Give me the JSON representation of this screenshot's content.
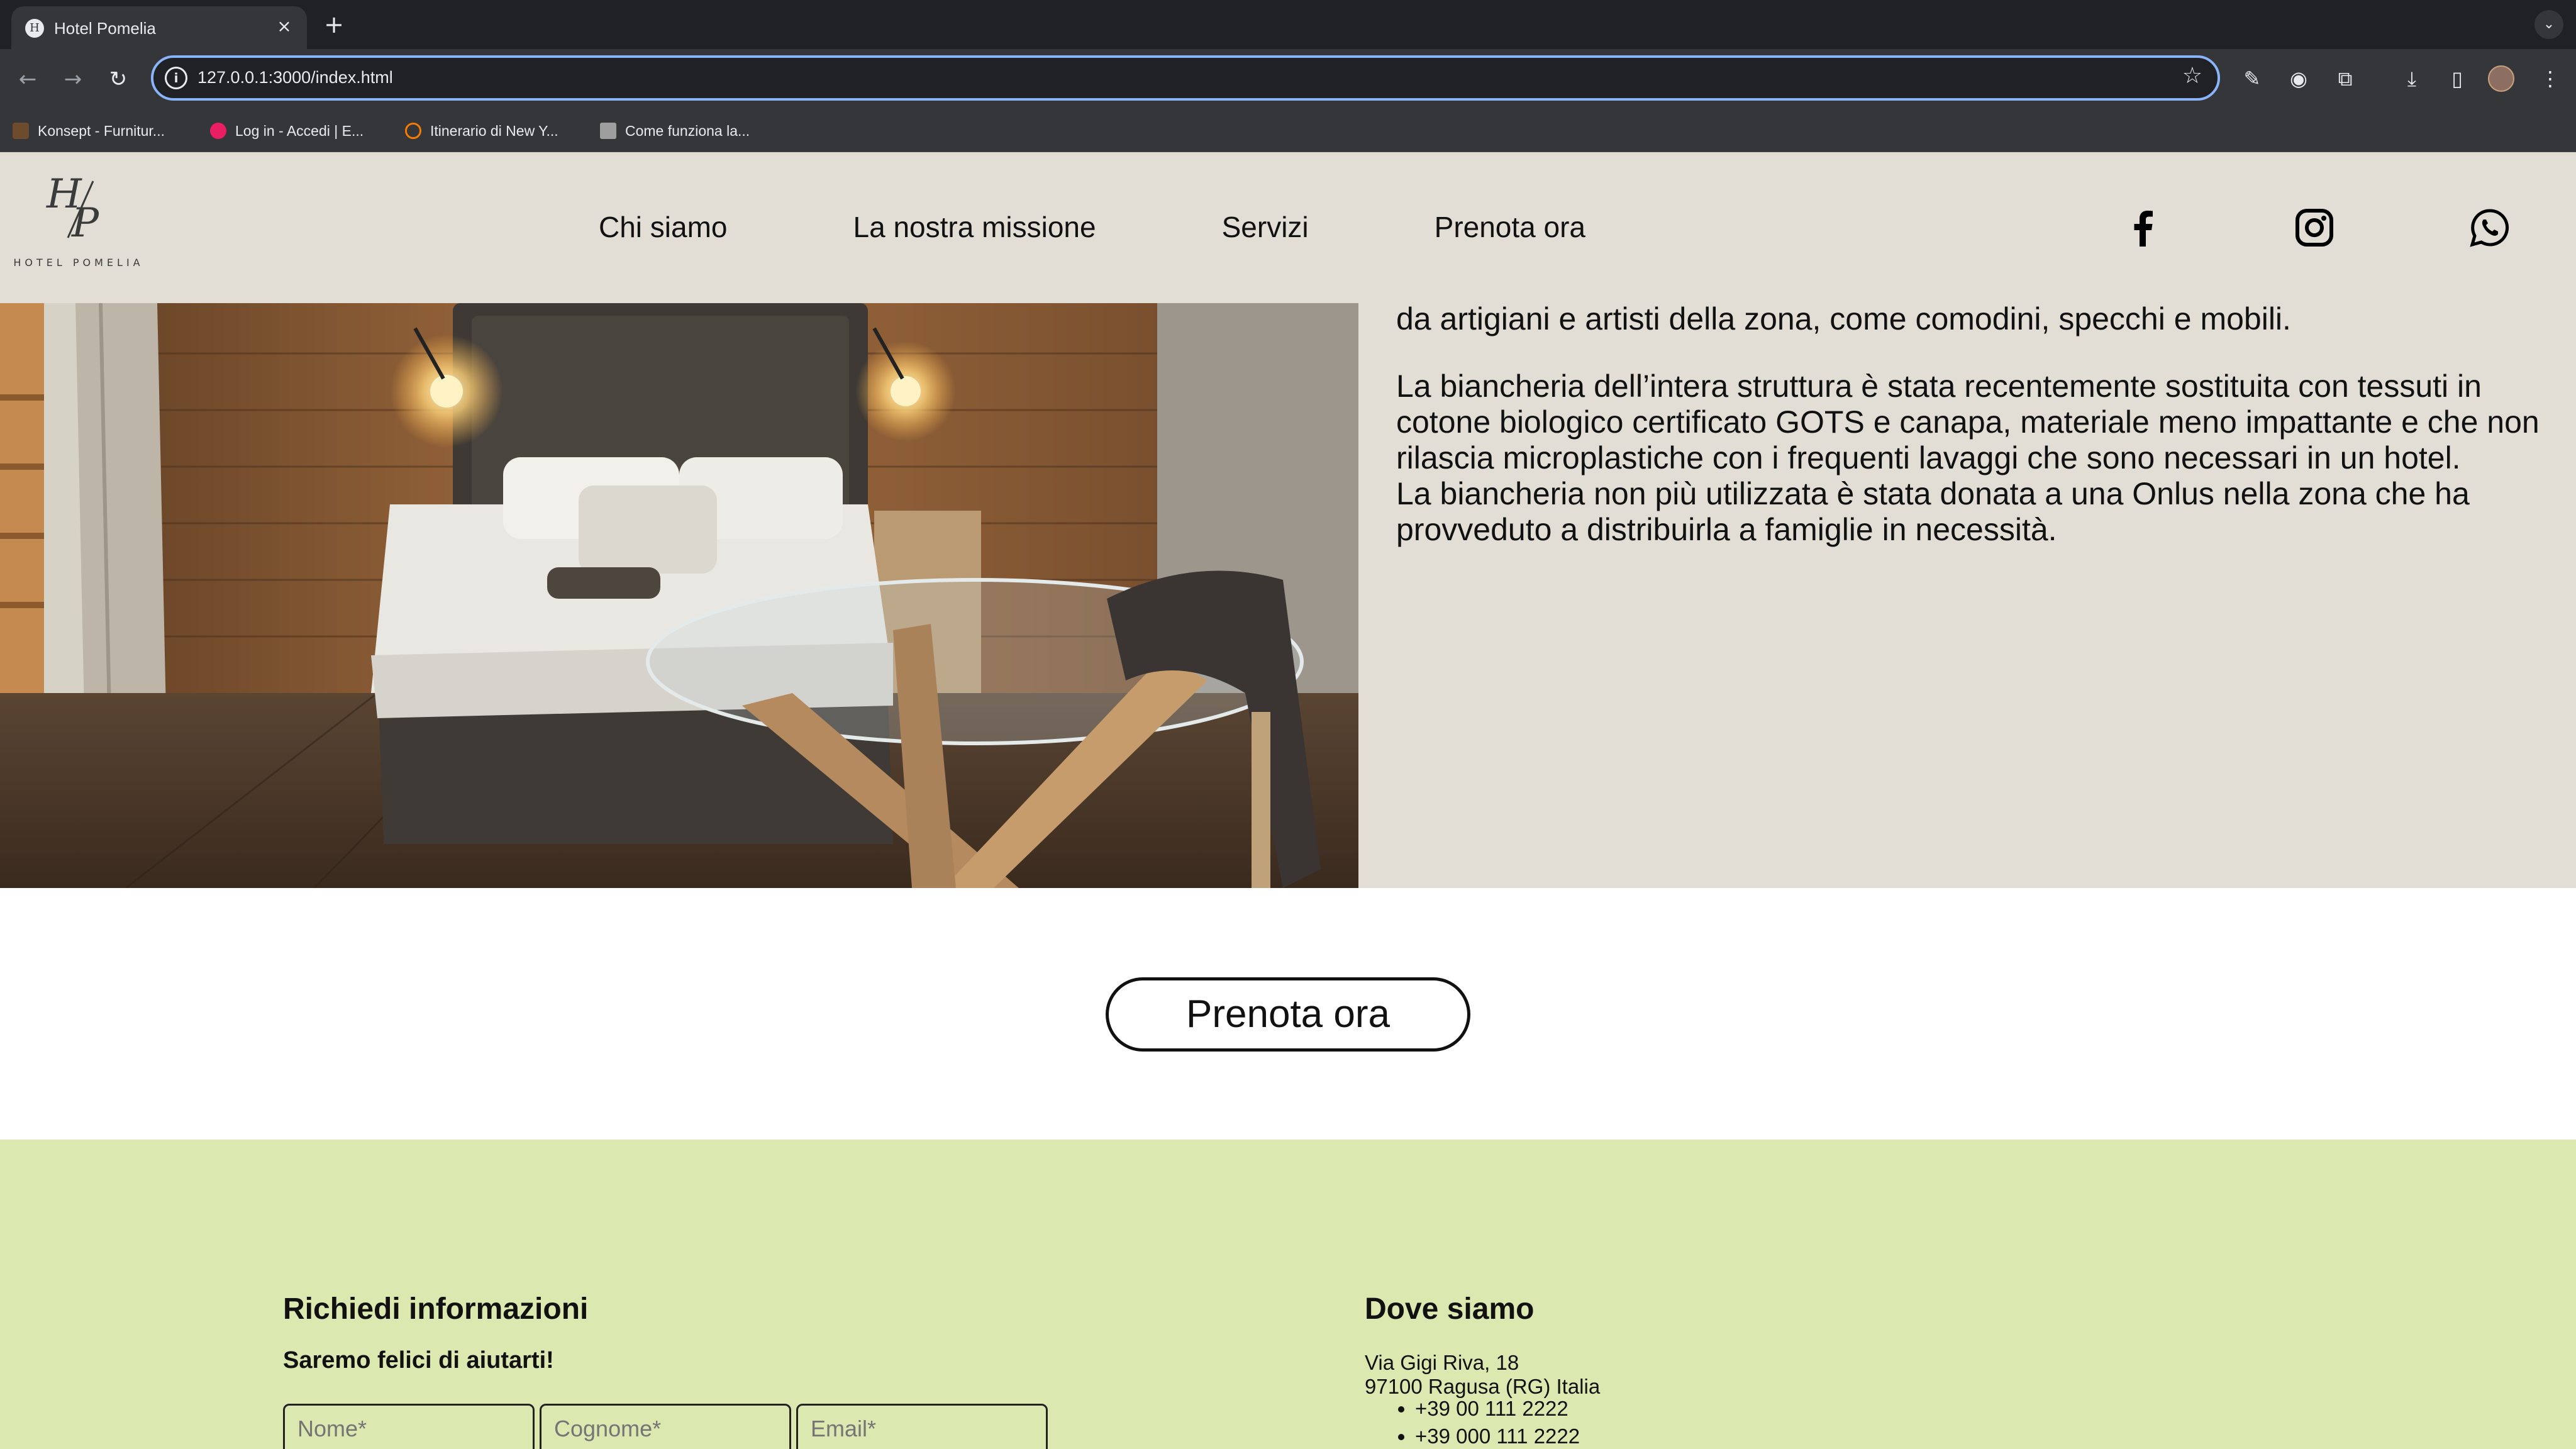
{
  "browser": {
    "tab_title": "Hotel Pomelia",
    "url": "127.0.0.1:3000/index.html",
    "bookmarks": [
      {
        "label": "Konsept - Furnitur...",
        "color": "#6d4c2e"
      },
      {
        "label": "Log in - Accedi | E...",
        "color": "#e91e63"
      },
      {
        "label": "Itinerario di New Y...",
        "color": "#f57c00"
      },
      {
        "label": "Come funziona la...",
        "color": "#9e9e9e"
      }
    ]
  },
  "site": {
    "logo_mark": "H/P",
    "logo_text": "HOTEL POMELIA",
    "nav": [
      "Chi siamo",
      "La nostra missione",
      "Servizi",
      "Prenota ora"
    ],
    "social_icons": [
      "facebook-icon",
      "instagram-icon",
      "whatsapp-icon"
    ]
  },
  "feature": {
    "paragraphs": [
      "Le camere sono dotate di arredamenti ricavati da materiali di recupero rielaborati da artigiani e artisti della zona, come comodini, specchi e mobili.",
      "La biancheria dell’intera struttura è stata recentemente sostituita con tessuti in cotone biologico certificato GOTS e canapa, materiale meno impattante e che non rilascia microplastiche con i frequenti lavaggi che sono necessari in un hotel.",
      "La biancheria non più utilizzata è stata donata a una Onlus nella zona che ha provveduto a distribuirla a famiglie in necessità."
    ]
  },
  "cta": {
    "label": "Prenota ora"
  },
  "footer": {
    "info_title": "Richiedi informazioni",
    "info_subtitle": "Saremo felici di aiutarti!",
    "form": {
      "first_name_placeholder": "Nome*",
      "last_name_placeholder": "Cognome*",
      "email_placeholder": "Email*"
    },
    "location_title": "Dove siamo",
    "address_line1": "Via Gigi Riva, 18",
    "address_line2": "97100 Ragusa (RG) Italia",
    "phones": [
      "+39 00 111 2222",
      "+39 000 111 2222"
    ]
  },
  "colors": {
    "header_bg": "#e2ded5",
    "footer_bg": "#dbe8b0",
    "chrome_bg": "#35363a",
    "omnibox_focus": "#8ab4f8"
  }
}
